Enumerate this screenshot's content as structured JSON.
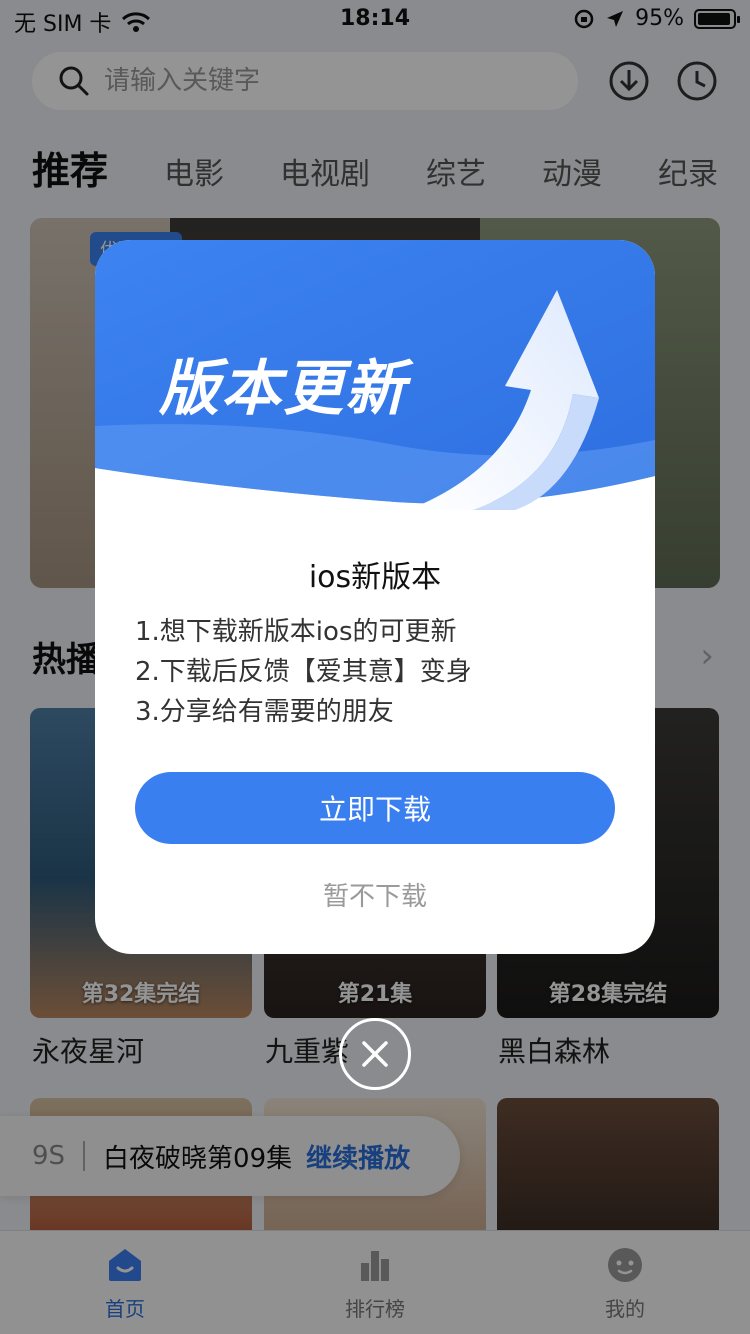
{
  "status_bar": {
    "carrier": "无 SIM 卡",
    "time": "18:14",
    "battery": "95%",
    "battery_level": 0.95
  },
  "search": {
    "placeholder": "请输入关键字"
  },
  "category_tabs": [
    "推荐",
    "电影",
    "电视剧",
    "综艺",
    "动漫",
    "纪录"
  ],
  "banner": {
    "tag": "优酷出品"
  },
  "hot_section": {
    "title": "热播"
  },
  "posters": [
    {
      "title": "永夜星河",
      "episode": "第32集完结"
    },
    {
      "title": "九重紫",
      "episode": "第21集"
    },
    {
      "title": "黑白森林",
      "episode": "第28集完结"
    }
  ],
  "continue_watching": {
    "seconds": "9S",
    "episode_title": "白夜破晓第09集",
    "resume_label": "继续播放"
  },
  "bottom_tabs": [
    {
      "label": "首页",
      "icon": "home-icon"
    },
    {
      "label": "排行榜",
      "icon": "ranking-icon"
    },
    {
      "label": "我的",
      "icon": "profile-icon"
    }
  ],
  "dialog": {
    "heading": "版本更新",
    "title": "ios新版本",
    "lines": [
      "1.想下载新版本ios的可更新",
      "2.下载后反馈【爱其意】变身",
      "3.分享给有需要的朋友"
    ],
    "download_label": "立即下载",
    "later_label": "暂不下载"
  },
  "colors": {
    "accent": "#3a7ff0",
    "link": "#2a6fd9"
  }
}
